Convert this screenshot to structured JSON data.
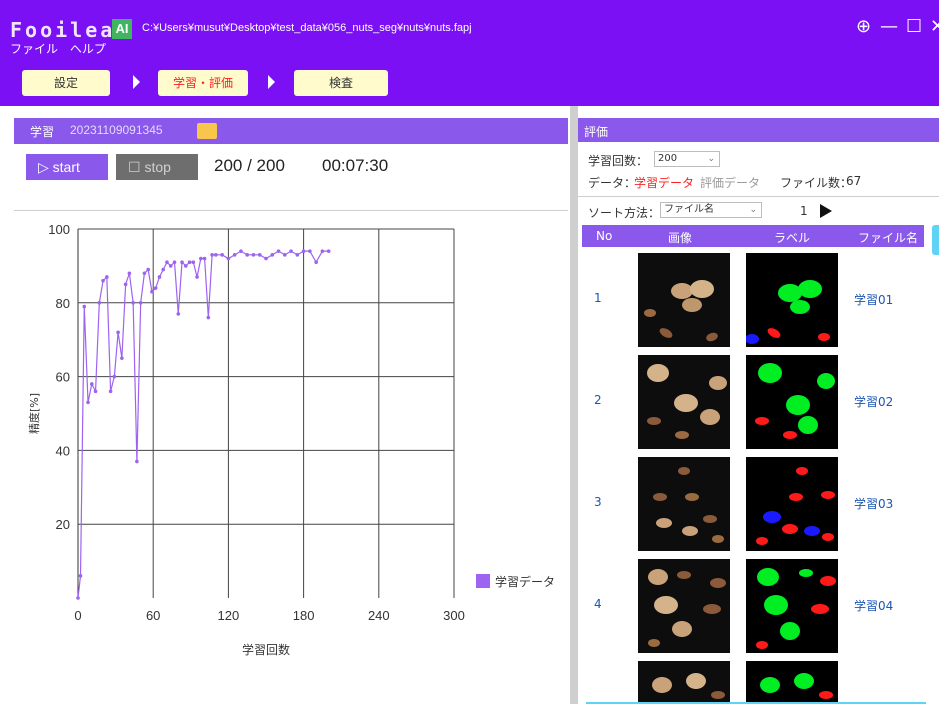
{
  "app": {
    "logo": "Fooilea",
    "badge": "AI",
    "file_path": "C:¥Users¥musut¥Desktop¥test_data¥056_nuts_seg¥nuts¥nuts.fapj"
  },
  "menu": [
    "ファイル",
    "ヘルプ"
  ],
  "steps": [
    {
      "label": "設定",
      "active": false
    },
    {
      "label": "学習・評価",
      "active": true
    },
    {
      "label": "検査",
      "active": false
    }
  ],
  "training": {
    "title": "学習",
    "id": "20231109091345",
    "start_label": "start",
    "stop_label": "stop",
    "progress": "200 / 200",
    "elapsed": "00:07:30"
  },
  "chart_data": {
    "type": "line",
    "title": "",
    "xlabel": "学習回数",
    "ylabel": "精度[%]",
    "xlim": [
      0,
      300
    ],
    "ylim": [
      0,
      100
    ],
    "xticks": [
      0,
      60,
      120,
      180,
      240,
      300
    ],
    "yticks": [
      20,
      40,
      60,
      80,
      100
    ],
    "grid": true,
    "legend_position": "right",
    "series": [
      {
        "name": "学習データ",
        "color": "#9e63f0",
        "x": [
          0,
          2,
          5,
          8,
          11,
          14,
          17,
          20,
          23,
          26,
          29,
          32,
          35,
          38,
          41,
          44,
          47,
          50,
          53,
          56,
          59,
          62,
          65,
          68,
          71,
          74,
          77,
          80,
          83,
          86,
          89,
          92,
          95,
          98,
          101,
          104,
          107,
          110,
          115,
          120,
          125,
          130,
          135,
          140,
          145,
          150,
          155,
          160,
          165,
          170,
          175,
          180,
          185,
          190,
          195,
          200
        ],
        "y": [
          0,
          6,
          79,
          53,
          58,
          56,
          80,
          86,
          87,
          56,
          60,
          72,
          65,
          85,
          88,
          80,
          37,
          80,
          88,
          89,
          83,
          84,
          87,
          89,
          91,
          90,
          91,
          77,
          91,
          90,
          91,
          91,
          87,
          92,
          92,
          76,
          93,
          93,
          93,
          92,
          93,
          94,
          93,
          93,
          93,
          92,
          93,
          94,
          93,
          94,
          93,
          94,
          94,
          91,
          94,
          94
        ]
      }
    ]
  },
  "evaluation": {
    "title": "評価",
    "epoch_label": "学習回数：",
    "epoch_value": "200",
    "data_label": "データ：",
    "data_active": "学習データ",
    "data_inactive": "評価データ",
    "file_count_label": "ファイル数：",
    "file_count": "67",
    "sort_label": "ソート方法：",
    "sort_value": "ファイル名",
    "page": "1",
    "columns": [
      "No",
      "画像",
      "ラベル",
      "ファイル名"
    ],
    "rows": [
      {
        "no": "1",
        "file": "学習01"
      },
      {
        "no": "2",
        "file": "学習02"
      },
      {
        "no": "3",
        "file": "学習03"
      },
      {
        "no": "4",
        "file": "学習04"
      },
      {
        "no": "",
        "file": ""
      }
    ]
  },
  "colors": {
    "accent": "#7b10f4",
    "panel_header": "#8a58ea",
    "step_button": "#fffbcc",
    "active_step_text": "#ff2020",
    "label_green": "#00ee22",
    "label_red": "#ff1a1a",
    "label_blue": "#1a1aff"
  }
}
